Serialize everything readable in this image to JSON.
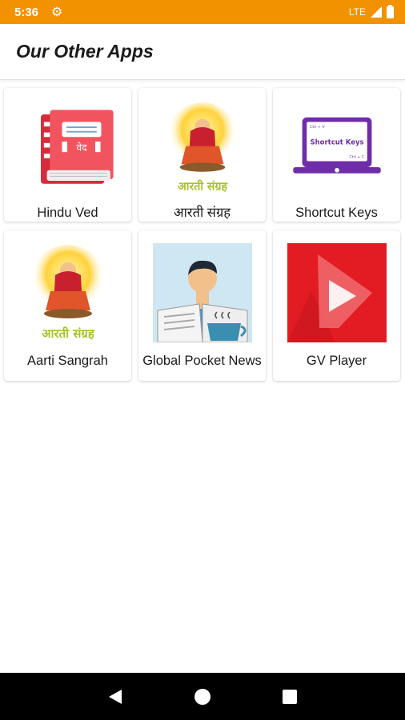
{
  "status_bar": {
    "time": "5:36",
    "network": "LTE",
    "icons": [
      "settings-gear-icon",
      "signal-icon",
      "battery-icon"
    ],
    "background": "#f39200"
  },
  "app_bar": {
    "title": "Our Other Apps"
  },
  "apps": [
    {
      "label": "Hindu Ved",
      "icon": "hindu-ved-book-icon",
      "icon_text": "वेद"
    },
    {
      "label": "आरती संग्रह",
      "icon": "aarti-sangrah-goddess-icon",
      "icon_text": "आरती संग्रह"
    },
    {
      "label": "Shortcut Keys",
      "icon": "shortcut-keys-laptop-icon",
      "icon_text": "Shortcut Keys",
      "icon_small_1": "Ctrl + V",
      "icon_small_2": "Ctrl + C"
    },
    {
      "label": "Aarti Sangrah",
      "icon": "aarti-sangrah-goddess-icon",
      "icon_text": "आरती संग्रह"
    },
    {
      "label": "Global Pocket News",
      "icon": "global-pocket-news-icon"
    },
    {
      "label": "GV Player",
      "icon": "gv-player-icon"
    }
  ],
  "nav_bar": {
    "buttons": [
      "back-icon",
      "home-icon",
      "recents-icon"
    ]
  }
}
